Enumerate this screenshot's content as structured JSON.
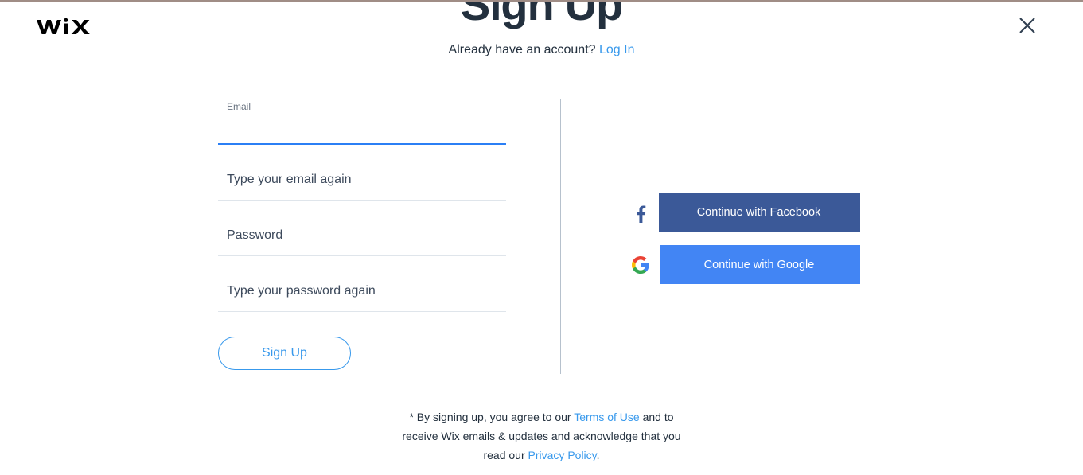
{
  "theme": {
    "accent_blue": "#3899ec",
    "focus_blue": "#2b7ff5",
    "title_color": "#23303e",
    "top_border_color": "#a08d86",
    "facebook_blue": "#3b5998",
    "google_blue": "#4285f4",
    "divider_color": "#b6c1cd",
    "field_underline": "#dfe5eb"
  },
  "brand": {
    "logo_text": "WiX",
    "logo_name": "wix-logo"
  },
  "header": {
    "title": "Sign Up",
    "subtitle_prefix": "Already have an account?",
    "login_link": "Log In",
    "close_label": "Close"
  },
  "form": {
    "fields": [
      {
        "name": "email",
        "label": "Email",
        "placeholder": "Email",
        "value": "",
        "focused": true
      },
      {
        "name": "email-confirm",
        "label": "Type your email again",
        "placeholder": "Type your email again",
        "value": "",
        "focused": false
      },
      {
        "name": "password",
        "label": "Password",
        "placeholder": "Password",
        "value": "",
        "focused": false
      },
      {
        "name": "password-confirm",
        "label": "Type your password again",
        "placeholder": "Type your password again",
        "value": "",
        "focused": false
      }
    ],
    "submit_label": "Sign Up"
  },
  "social": {
    "facebook_label": "Continue with Facebook",
    "facebook_icon": "facebook-icon",
    "google_label": "Continue with Google",
    "google_icon": "google-icon"
  },
  "footer": {
    "text_part1": "* By signing up, you agree to our ",
    "terms_link": "Terms of Use",
    "text_part2": " and to receive Wix emails & updates and acknowledge that you read our ",
    "privacy_link": "Privacy Policy",
    "text_part3": "."
  }
}
